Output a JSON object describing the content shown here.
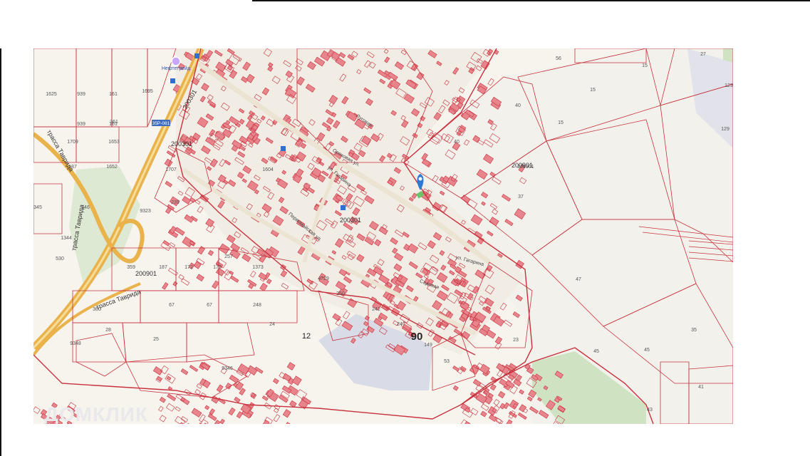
{
  "map": {
    "watermark": "ДОМКЛИК",
    "block_ids": [
      "200301",
      "200301",
      "200301",
      "200901",
      "200901"
    ],
    "highway_labels": [
      "трасса Таврида",
      "трасса Таврида",
      "трасса Таврида"
    ],
    "road_badge": "35Р-081",
    "poi": "Нефтетрейд",
    "streets": [
      "ул. Гагарина",
      "ул. Гагарина",
      "Луговая",
      "Ореховая ул.",
      "Первомайская ул.",
      "Садовая"
    ],
    "big_labels": [
      "90",
      "12"
    ],
    "parcel_numbers": [
      "1625",
      "939",
      "161",
      "1695",
      "939",
      "161",
      "1709",
      "1653",
      "187",
      "1652",
      "345",
      "546",
      "9323",
      "239",
      "1344",
      "530",
      "359",
      "187",
      "172",
      "172",
      "257",
      "1373",
      "360",
      "67",
      "67",
      "248",
      "28",
      "25",
      "24",
      "9348",
      "9346",
      "4729",
      "250",
      "242",
      "247",
      "149",
      "53",
      "56",
      "15",
      "15",
      "40",
      "40",
      "37",
      "15",
      "47",
      "35",
      "45",
      "45",
      "41",
      "43",
      "27",
      "129",
      "129",
      "23",
      "200901",
      "1707",
      "1604",
      "361"
    ],
    "colors": {
      "parcel_line": "#c8323e",
      "building_fill": "#e8858c",
      "highway": "#e9b24a",
      "highway_center": "#f6dd9a",
      "green": "#cfe3c2",
      "industrial": "#d9dbe6",
      "marker": "#2979d6",
      "marker_green": "#6cc36c"
    }
  }
}
